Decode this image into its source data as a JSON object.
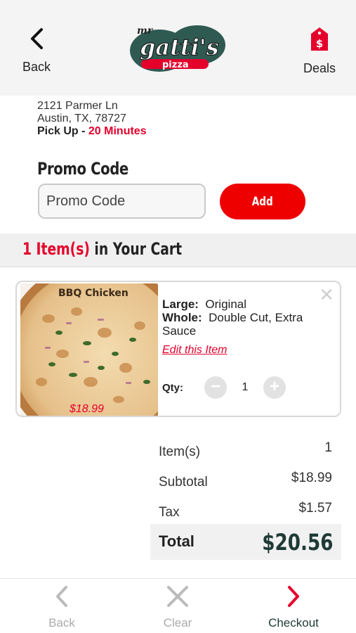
{
  "header": {
    "back_label": "Back",
    "deals_label": "Deals",
    "deals_icon": "price-tag-dollar-icon",
    "logo_top": "mr",
    "logo_main": "gatti's",
    "logo_sub": "pizza"
  },
  "store": {
    "address_line1": "2121 Parmer Ln",
    "address_line2": "Austin, TX, 78727",
    "pickup_label": "Pick Up - ",
    "pickup_time": "20 Minutes"
  },
  "promo": {
    "title": "Promo Code",
    "placeholder": "Promo Code",
    "value": "",
    "add_label": "Add"
  },
  "cart": {
    "count_text": "1 Item(s)",
    "rest_text": " in Your Cart"
  },
  "item": {
    "name": "BBQ Chicken",
    "price": "$18.99",
    "size_label": "Large:",
    "size_value": "Original",
    "whole_label": "Whole:",
    "whole_value": "Double Cut, Extra Sauce",
    "edit_label": "Edit this Item",
    "qty_label": "Qty:",
    "qty_value": "1",
    "minus": "−",
    "plus": "+",
    "remove": "✕"
  },
  "summary": {
    "rows": [
      {
        "label": "Item(s)",
        "value": "1"
      },
      {
        "label": "Subtotal",
        "value": "$18.99"
      },
      {
        "label": "Tax",
        "value": "$1.57"
      }
    ],
    "total_label": "Total",
    "total_value": "$20.56"
  },
  "footer": {
    "back_label": "Back",
    "clear_label": "Clear",
    "checkout_label": "Checkout"
  },
  "colors": {
    "accent_red": "#e4002b",
    "dark_green": "#1f3a36",
    "disabled_gray": "#aaaaaa"
  }
}
